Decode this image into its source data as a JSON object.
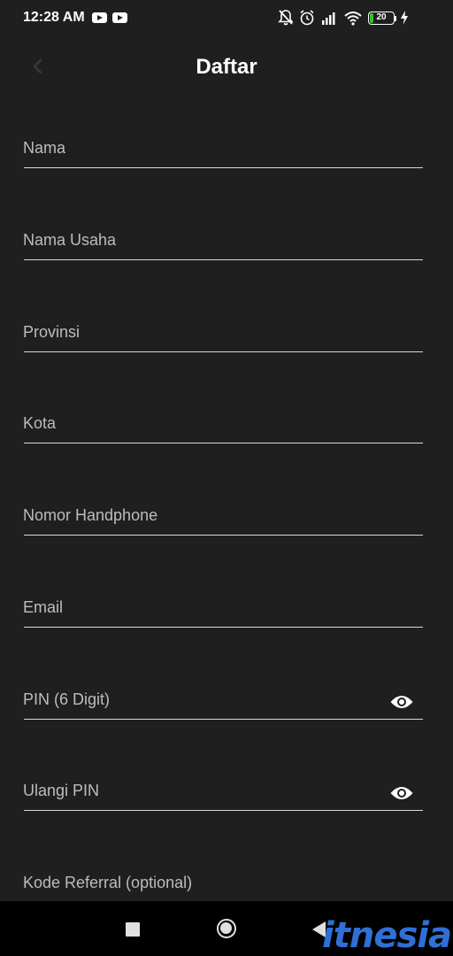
{
  "status_bar": {
    "time": "12:28 AM",
    "battery_level": "20",
    "battery_percent": 20,
    "icons": [
      "youtube-icon",
      "youtube-icon",
      "mute-notifications-icon",
      "alarm-icon",
      "signal-icon",
      "wifi-icon",
      "battery-icon",
      "charging-icon"
    ]
  },
  "header": {
    "title": "Daftar",
    "back_icon": "chevron-left-icon"
  },
  "form": {
    "fields": [
      {
        "label": "Nama"
      },
      {
        "label": "Nama Usaha"
      },
      {
        "label": "Provinsi"
      },
      {
        "label": "Kota"
      },
      {
        "label": "Nomor Handphone"
      },
      {
        "label": "Email"
      },
      {
        "label": "PIN (6 Digit)",
        "icon": "eye-icon"
      },
      {
        "label": "Ulangi PIN",
        "icon": "eye-icon"
      },
      {
        "label": "Kode Referral (optional)"
      }
    ]
  },
  "nav_bar": {
    "buttons": [
      "recents-icon",
      "home-icon",
      "back-icon"
    ]
  },
  "watermark": {
    "text": "itnesia"
  },
  "colors": {
    "background": "#1f1f1f",
    "label": "#bdbdbd",
    "underline": "#d9d9d9",
    "battery_fill": "#35c335",
    "watermark": "#2f6fd6"
  }
}
